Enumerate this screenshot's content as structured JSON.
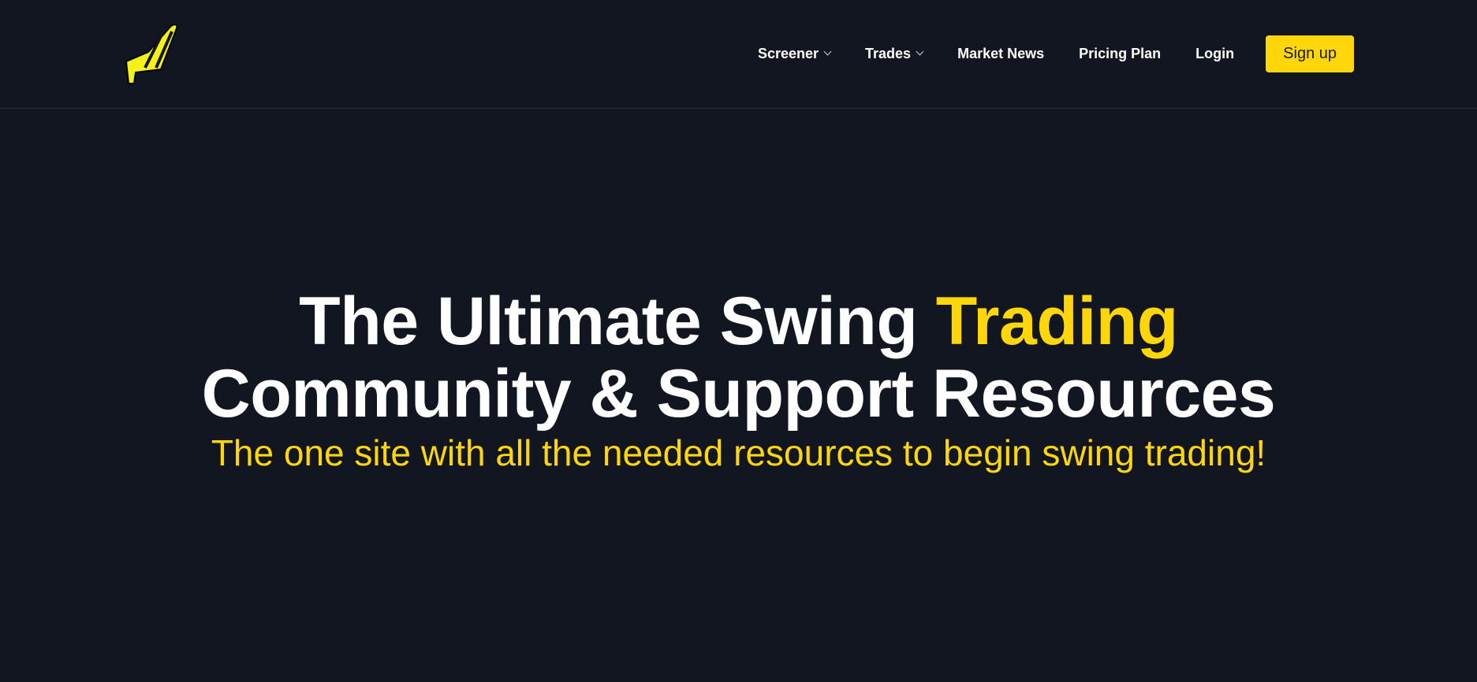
{
  "brand": {
    "logo_icon": "rocket-swoosh-icon",
    "accent_color": "#ffd60a",
    "background_color": "#111620"
  },
  "nav": {
    "screener_label": "Screener",
    "trades_label": "Trades",
    "market_news_label": "Market News",
    "pricing_label": "Pricing Plan",
    "login_label": "Login",
    "signup_label": "Sign up"
  },
  "hero": {
    "title_line1_white": "The Ultimate Swing",
    "title_line1_accent": "Trading",
    "title_line2": "Community & Support Resources",
    "subtitle": "The one site with all the needed resources to begin swing trading!"
  }
}
